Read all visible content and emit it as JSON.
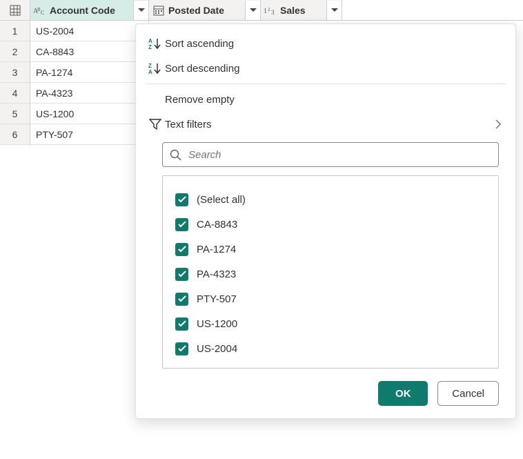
{
  "columns": [
    {
      "name": "Account Code",
      "type_icon": "text"
    },
    {
      "name": "Posted Date",
      "type_icon": "date"
    },
    {
      "name": "Sales",
      "type_icon": "number"
    }
  ],
  "rows": [
    {
      "n": "1",
      "account_code": "US-2004"
    },
    {
      "n": "2",
      "account_code": "CA-8843"
    },
    {
      "n": "3",
      "account_code": "PA-1274"
    },
    {
      "n": "4",
      "account_code": "PA-4323"
    },
    {
      "n": "5",
      "account_code": "US-1200"
    },
    {
      "n": "6",
      "account_code": "PTY-507"
    }
  ],
  "dropdown": {
    "sort_asc": "Sort ascending",
    "sort_desc": "Sort descending",
    "remove_empty": "Remove empty",
    "text_filters": "Text filters",
    "search_placeholder": "Search",
    "filter_values": [
      "(Select all)",
      "CA-8843",
      "PA-1274",
      "PA-4323",
      "PTY-507",
      "US-1200",
      "US-2004"
    ],
    "ok": "OK",
    "cancel": "Cancel"
  }
}
